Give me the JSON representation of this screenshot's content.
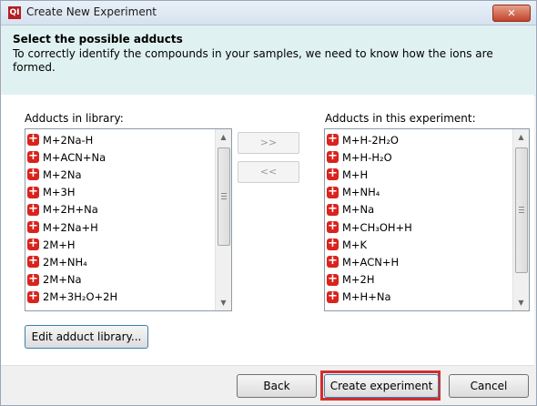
{
  "window": {
    "app_icon_text": "QI",
    "title": "Create New Experiment",
    "close_label": "✕"
  },
  "header": {
    "title": "Select the possible adducts",
    "description": "To correctly identify the compounds in your samples, we need to know how the ions are formed."
  },
  "library": {
    "label": "Adducts in library:",
    "items": [
      "M+2Na-H",
      "M+ACN+Na",
      "M+2Na",
      "M+3H",
      "M+2H+Na",
      "M+2Na+H",
      "2M+H",
      "2M+NH₄",
      "2M+Na",
      "2M+3H₂O+2H"
    ]
  },
  "experiment": {
    "label": "Adducts in this experiment:",
    "items": [
      "M+H-2H₂O",
      "M+H-H₂O",
      "M+H",
      "M+NH₄",
      "M+Na",
      "M+CH₃OH+H",
      "M+K",
      "M+ACN+H",
      "M+2H",
      "M+H+Na"
    ]
  },
  "move": {
    "add_label": ">>",
    "remove_label": "<<"
  },
  "buttons": {
    "edit_library": "Edit adduct library...",
    "back": "Back",
    "create": "Create experiment",
    "cancel": "Cancel"
  },
  "icons": {
    "add": "plus-icon",
    "scroll_up": "arrow-up-icon",
    "scroll_down": "arrow-down-icon"
  },
  "colors": {
    "header_band": "#dff2f1",
    "plus_icon": "#d9231c",
    "highlight": "#d42d2d"
  }
}
